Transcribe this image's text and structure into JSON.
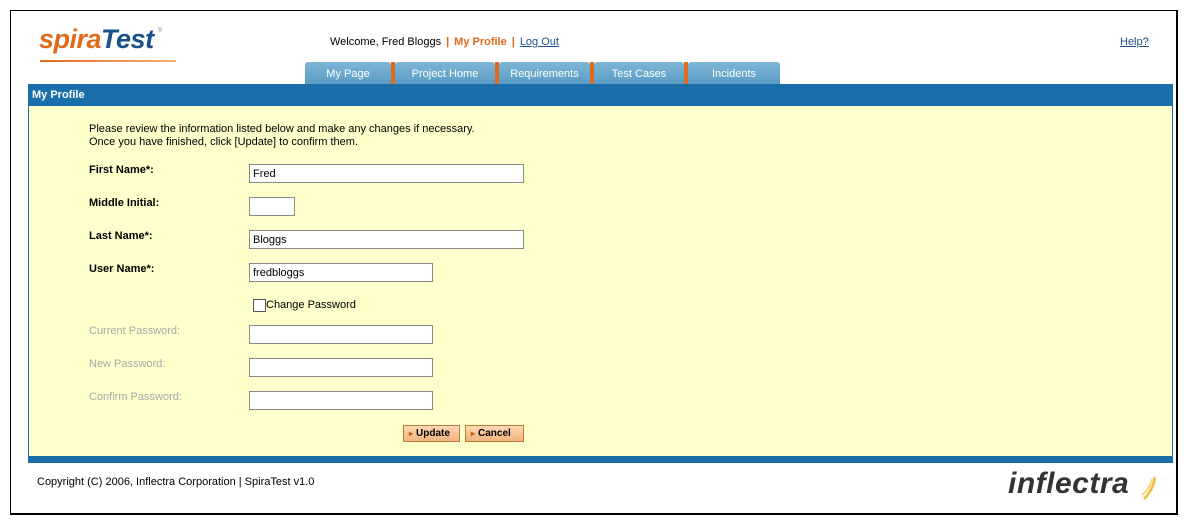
{
  "logo": {
    "part1": "spira",
    "part2": "Test",
    "tm": "®"
  },
  "header": {
    "welcome": "Welcome, Fred Bloggs",
    "sep1": "|",
    "my_profile": "My Profile",
    "sep2": "|",
    "log_out": "Log Out",
    "help": "Help?"
  },
  "tabs": [
    {
      "label": "My Page"
    },
    {
      "label": "Project Home"
    },
    {
      "label": "Requirements"
    },
    {
      "label": "Test Cases"
    },
    {
      "label": "Incidents"
    }
  ],
  "page_title": "My Profile",
  "intro": {
    "line1": "Please review the information listed below and make any changes if necessary.",
    "line2": "Once you have finished, click [Update] to confirm them."
  },
  "form": {
    "first_name_label": "First Name*:",
    "first_name_value": "Fred",
    "middle_initial_label": "Middle Initial:",
    "middle_initial_value": "",
    "last_name_label": "Last Name*:",
    "last_name_value": "Bloggs",
    "user_name_label": "User Name*:",
    "user_name_value": "fredbloggs",
    "change_password_label": "Change Password",
    "change_password_checked": false,
    "current_password_label": "Current Password:",
    "new_password_label": "New Password:",
    "confirm_password_label": "Confirm Password:"
  },
  "buttons": {
    "update": "Update",
    "cancel": "Cancel",
    "arrow": "▸"
  },
  "footer": {
    "copyright": "Copyright (C) 2006, Inflectra Corporation | SpiraTest v1.0",
    "brand": "inflectra"
  },
  "colors": {
    "brand_orange": "#e06a1c",
    "brand_blue": "#1a6fab",
    "panel_bg": "#ffffcc"
  }
}
